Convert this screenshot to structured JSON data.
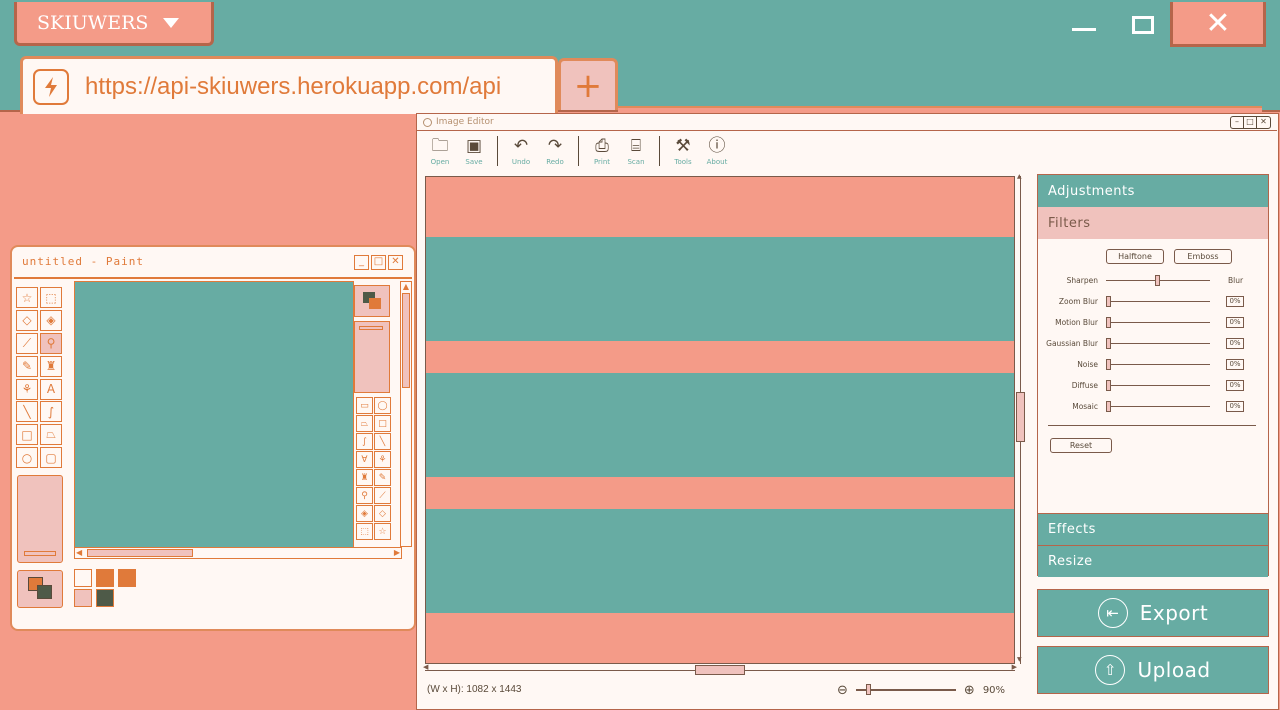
{
  "browser": {
    "brand_label": "SKIUWERS",
    "url": "https://api-skiuwers.herokuapp.com/api",
    "new_tab_label": "+",
    "close_label": "✕"
  },
  "paint": {
    "title": "untitled - Paint"
  },
  "editor": {
    "title": "Image Editor",
    "toolbar": {
      "open": "Open",
      "save": "Save",
      "undo": "Undo",
      "redo": "Redo",
      "print": "Print",
      "scan": "Scan",
      "tools": "Tools",
      "about": "About"
    },
    "image_stripes": [
      "#f49b88",
      "#67aca3",
      "#f49b88",
      "#67aca3",
      "#f49b88",
      "#67aca3",
      "#f49b88"
    ],
    "dimensions": "(W x H): 1082 x 1443",
    "zoom": "90%",
    "panel": {
      "adjustments": "Adjustments",
      "filters": "Filters",
      "halftone": "Halftone",
      "emboss": "Emboss",
      "sharpen": "Sharpen",
      "blur": "Blur",
      "sliders": [
        {
          "label": "Zoom Blur",
          "value": "0%"
        },
        {
          "label": "Motion Blur",
          "value": "0%"
        },
        {
          "label": "Gaussian Blur",
          "value": "0%"
        },
        {
          "label": "Noise",
          "value": "0%"
        },
        {
          "label": "Diffuse",
          "value": "0%"
        },
        {
          "label": "Mosaic",
          "value": "0%"
        }
      ],
      "reset": "Reset",
      "effects": "Effects",
      "resize": "Resize"
    },
    "export": "Export",
    "upload": "Upload"
  },
  "colors": {
    "teal": "#67aca3",
    "salmon": "#f49b88",
    "orange": "#e07a3a",
    "pink": "#f0c2bd"
  }
}
